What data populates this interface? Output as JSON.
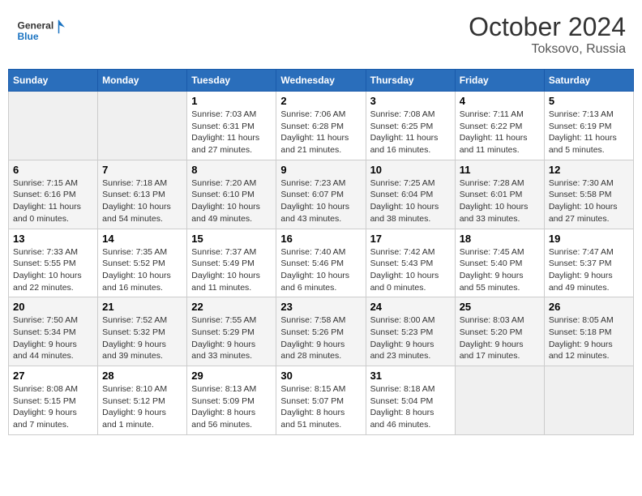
{
  "logo": {
    "line1": "General",
    "line2": "Blue"
  },
  "title": "October 2024",
  "location": "Toksovo, Russia",
  "days_of_week": [
    "Sunday",
    "Monday",
    "Tuesday",
    "Wednesday",
    "Thursday",
    "Friday",
    "Saturday"
  ],
  "weeks": [
    [
      {
        "num": "",
        "sunrise": "",
        "sunset": "",
        "daylight": ""
      },
      {
        "num": "",
        "sunrise": "",
        "sunset": "",
        "daylight": ""
      },
      {
        "num": "1",
        "sunrise": "Sunrise: 7:03 AM",
        "sunset": "Sunset: 6:31 PM",
        "daylight": "Daylight: 11 hours and 27 minutes."
      },
      {
        "num": "2",
        "sunrise": "Sunrise: 7:06 AM",
        "sunset": "Sunset: 6:28 PM",
        "daylight": "Daylight: 11 hours and 21 minutes."
      },
      {
        "num": "3",
        "sunrise": "Sunrise: 7:08 AM",
        "sunset": "Sunset: 6:25 PM",
        "daylight": "Daylight: 11 hours and 16 minutes."
      },
      {
        "num": "4",
        "sunrise": "Sunrise: 7:11 AM",
        "sunset": "Sunset: 6:22 PM",
        "daylight": "Daylight: 11 hours and 11 minutes."
      },
      {
        "num": "5",
        "sunrise": "Sunrise: 7:13 AM",
        "sunset": "Sunset: 6:19 PM",
        "daylight": "Daylight: 11 hours and 5 minutes."
      }
    ],
    [
      {
        "num": "6",
        "sunrise": "Sunrise: 7:15 AM",
        "sunset": "Sunset: 6:16 PM",
        "daylight": "Daylight: 11 hours and 0 minutes."
      },
      {
        "num": "7",
        "sunrise": "Sunrise: 7:18 AM",
        "sunset": "Sunset: 6:13 PM",
        "daylight": "Daylight: 10 hours and 54 minutes."
      },
      {
        "num": "8",
        "sunrise": "Sunrise: 7:20 AM",
        "sunset": "Sunset: 6:10 PM",
        "daylight": "Daylight: 10 hours and 49 minutes."
      },
      {
        "num": "9",
        "sunrise": "Sunrise: 7:23 AM",
        "sunset": "Sunset: 6:07 PM",
        "daylight": "Daylight: 10 hours and 43 minutes."
      },
      {
        "num": "10",
        "sunrise": "Sunrise: 7:25 AM",
        "sunset": "Sunset: 6:04 PM",
        "daylight": "Daylight: 10 hours and 38 minutes."
      },
      {
        "num": "11",
        "sunrise": "Sunrise: 7:28 AM",
        "sunset": "Sunset: 6:01 PM",
        "daylight": "Daylight: 10 hours and 33 minutes."
      },
      {
        "num": "12",
        "sunrise": "Sunrise: 7:30 AM",
        "sunset": "Sunset: 5:58 PM",
        "daylight": "Daylight: 10 hours and 27 minutes."
      }
    ],
    [
      {
        "num": "13",
        "sunrise": "Sunrise: 7:33 AM",
        "sunset": "Sunset: 5:55 PM",
        "daylight": "Daylight: 10 hours and 22 minutes."
      },
      {
        "num": "14",
        "sunrise": "Sunrise: 7:35 AM",
        "sunset": "Sunset: 5:52 PM",
        "daylight": "Daylight: 10 hours and 16 minutes."
      },
      {
        "num": "15",
        "sunrise": "Sunrise: 7:37 AM",
        "sunset": "Sunset: 5:49 PM",
        "daylight": "Daylight: 10 hours and 11 minutes."
      },
      {
        "num": "16",
        "sunrise": "Sunrise: 7:40 AM",
        "sunset": "Sunset: 5:46 PM",
        "daylight": "Daylight: 10 hours and 6 minutes."
      },
      {
        "num": "17",
        "sunrise": "Sunrise: 7:42 AM",
        "sunset": "Sunset: 5:43 PM",
        "daylight": "Daylight: 10 hours and 0 minutes."
      },
      {
        "num": "18",
        "sunrise": "Sunrise: 7:45 AM",
        "sunset": "Sunset: 5:40 PM",
        "daylight": "Daylight: 9 hours and 55 minutes."
      },
      {
        "num": "19",
        "sunrise": "Sunrise: 7:47 AM",
        "sunset": "Sunset: 5:37 PM",
        "daylight": "Daylight: 9 hours and 49 minutes."
      }
    ],
    [
      {
        "num": "20",
        "sunrise": "Sunrise: 7:50 AM",
        "sunset": "Sunset: 5:34 PM",
        "daylight": "Daylight: 9 hours and 44 minutes."
      },
      {
        "num": "21",
        "sunrise": "Sunrise: 7:52 AM",
        "sunset": "Sunset: 5:32 PM",
        "daylight": "Daylight: 9 hours and 39 minutes."
      },
      {
        "num": "22",
        "sunrise": "Sunrise: 7:55 AM",
        "sunset": "Sunset: 5:29 PM",
        "daylight": "Daylight: 9 hours and 33 minutes."
      },
      {
        "num": "23",
        "sunrise": "Sunrise: 7:58 AM",
        "sunset": "Sunset: 5:26 PM",
        "daylight": "Daylight: 9 hours and 28 minutes."
      },
      {
        "num": "24",
        "sunrise": "Sunrise: 8:00 AM",
        "sunset": "Sunset: 5:23 PM",
        "daylight": "Daylight: 9 hours and 23 minutes."
      },
      {
        "num": "25",
        "sunrise": "Sunrise: 8:03 AM",
        "sunset": "Sunset: 5:20 PM",
        "daylight": "Daylight: 9 hours and 17 minutes."
      },
      {
        "num": "26",
        "sunrise": "Sunrise: 8:05 AM",
        "sunset": "Sunset: 5:18 PM",
        "daylight": "Daylight: 9 hours and 12 minutes."
      }
    ],
    [
      {
        "num": "27",
        "sunrise": "Sunrise: 8:08 AM",
        "sunset": "Sunset: 5:15 PM",
        "daylight": "Daylight: 9 hours and 7 minutes."
      },
      {
        "num": "28",
        "sunrise": "Sunrise: 8:10 AM",
        "sunset": "Sunset: 5:12 PM",
        "daylight": "Daylight: 9 hours and 1 minute."
      },
      {
        "num": "29",
        "sunrise": "Sunrise: 8:13 AM",
        "sunset": "Sunset: 5:09 PM",
        "daylight": "Daylight: 8 hours and 56 minutes."
      },
      {
        "num": "30",
        "sunrise": "Sunrise: 8:15 AM",
        "sunset": "Sunset: 5:07 PM",
        "daylight": "Daylight: 8 hours and 51 minutes."
      },
      {
        "num": "31",
        "sunrise": "Sunrise: 8:18 AM",
        "sunset": "Sunset: 5:04 PM",
        "daylight": "Daylight: 8 hours and 46 minutes."
      },
      {
        "num": "",
        "sunrise": "",
        "sunset": "",
        "daylight": ""
      },
      {
        "num": "",
        "sunrise": "",
        "sunset": "",
        "daylight": ""
      }
    ]
  ]
}
